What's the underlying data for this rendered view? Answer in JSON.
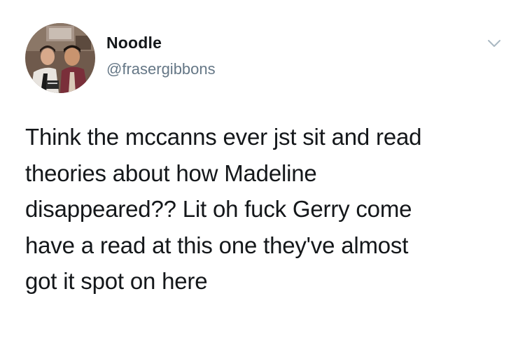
{
  "tweet": {
    "author": {
      "display_name": "Noodle",
      "handle": "@frasergibbons",
      "avatar_icon": "profile-photo"
    },
    "menu_icon": "chevron-down-icon",
    "text_lines": [
      "Think the mccanns ever jst sit and read",
      "theories about how Madeline",
      "disappeared?? Lit oh fuck Gerry come",
      "have a read at this one they've almost",
      "got it spot on here"
    ]
  },
  "colors": {
    "text": "#14171a",
    "secondary_text": "#657786",
    "chevron": "#aab8c2",
    "background": "#ffffff"
  }
}
